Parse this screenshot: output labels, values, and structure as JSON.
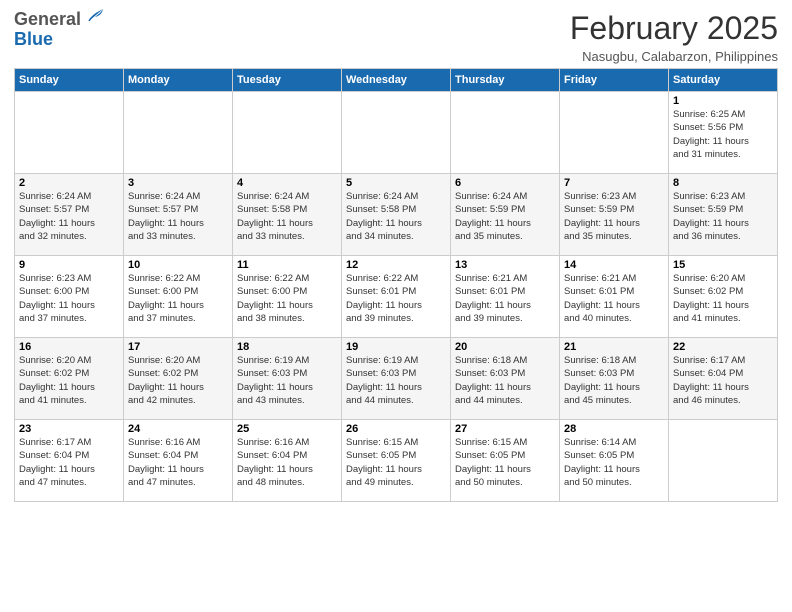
{
  "header": {
    "logo_general": "General",
    "logo_blue": "Blue",
    "month_title": "February 2025",
    "location": "Nasugbu, Calabarzon, Philippines"
  },
  "days_of_week": [
    "Sunday",
    "Monday",
    "Tuesday",
    "Wednesday",
    "Thursday",
    "Friday",
    "Saturday"
  ],
  "weeks": [
    [
      {
        "day": "",
        "info": ""
      },
      {
        "day": "",
        "info": ""
      },
      {
        "day": "",
        "info": ""
      },
      {
        "day": "",
        "info": ""
      },
      {
        "day": "",
        "info": ""
      },
      {
        "day": "",
        "info": ""
      },
      {
        "day": "1",
        "info": "Sunrise: 6:25 AM\nSunset: 5:56 PM\nDaylight: 11 hours\nand 31 minutes."
      }
    ],
    [
      {
        "day": "2",
        "info": "Sunrise: 6:24 AM\nSunset: 5:57 PM\nDaylight: 11 hours\nand 32 minutes."
      },
      {
        "day": "3",
        "info": "Sunrise: 6:24 AM\nSunset: 5:57 PM\nDaylight: 11 hours\nand 33 minutes."
      },
      {
        "day": "4",
        "info": "Sunrise: 6:24 AM\nSunset: 5:58 PM\nDaylight: 11 hours\nand 33 minutes."
      },
      {
        "day": "5",
        "info": "Sunrise: 6:24 AM\nSunset: 5:58 PM\nDaylight: 11 hours\nand 34 minutes."
      },
      {
        "day": "6",
        "info": "Sunrise: 6:24 AM\nSunset: 5:59 PM\nDaylight: 11 hours\nand 35 minutes."
      },
      {
        "day": "7",
        "info": "Sunrise: 6:23 AM\nSunset: 5:59 PM\nDaylight: 11 hours\nand 35 minutes."
      },
      {
        "day": "8",
        "info": "Sunrise: 6:23 AM\nSunset: 5:59 PM\nDaylight: 11 hours\nand 36 minutes."
      }
    ],
    [
      {
        "day": "9",
        "info": "Sunrise: 6:23 AM\nSunset: 6:00 PM\nDaylight: 11 hours\nand 37 minutes."
      },
      {
        "day": "10",
        "info": "Sunrise: 6:22 AM\nSunset: 6:00 PM\nDaylight: 11 hours\nand 37 minutes."
      },
      {
        "day": "11",
        "info": "Sunrise: 6:22 AM\nSunset: 6:00 PM\nDaylight: 11 hours\nand 38 minutes."
      },
      {
        "day": "12",
        "info": "Sunrise: 6:22 AM\nSunset: 6:01 PM\nDaylight: 11 hours\nand 39 minutes."
      },
      {
        "day": "13",
        "info": "Sunrise: 6:21 AM\nSunset: 6:01 PM\nDaylight: 11 hours\nand 39 minutes."
      },
      {
        "day": "14",
        "info": "Sunrise: 6:21 AM\nSunset: 6:01 PM\nDaylight: 11 hours\nand 40 minutes."
      },
      {
        "day": "15",
        "info": "Sunrise: 6:20 AM\nSunset: 6:02 PM\nDaylight: 11 hours\nand 41 minutes."
      }
    ],
    [
      {
        "day": "16",
        "info": "Sunrise: 6:20 AM\nSunset: 6:02 PM\nDaylight: 11 hours\nand 41 minutes."
      },
      {
        "day": "17",
        "info": "Sunrise: 6:20 AM\nSunset: 6:02 PM\nDaylight: 11 hours\nand 42 minutes."
      },
      {
        "day": "18",
        "info": "Sunrise: 6:19 AM\nSunset: 6:03 PM\nDaylight: 11 hours\nand 43 minutes."
      },
      {
        "day": "19",
        "info": "Sunrise: 6:19 AM\nSunset: 6:03 PM\nDaylight: 11 hours\nand 44 minutes."
      },
      {
        "day": "20",
        "info": "Sunrise: 6:18 AM\nSunset: 6:03 PM\nDaylight: 11 hours\nand 44 minutes."
      },
      {
        "day": "21",
        "info": "Sunrise: 6:18 AM\nSunset: 6:03 PM\nDaylight: 11 hours\nand 45 minutes."
      },
      {
        "day": "22",
        "info": "Sunrise: 6:17 AM\nSunset: 6:04 PM\nDaylight: 11 hours\nand 46 minutes."
      }
    ],
    [
      {
        "day": "23",
        "info": "Sunrise: 6:17 AM\nSunset: 6:04 PM\nDaylight: 11 hours\nand 47 minutes."
      },
      {
        "day": "24",
        "info": "Sunrise: 6:16 AM\nSunset: 6:04 PM\nDaylight: 11 hours\nand 47 minutes."
      },
      {
        "day": "25",
        "info": "Sunrise: 6:16 AM\nSunset: 6:04 PM\nDaylight: 11 hours\nand 48 minutes."
      },
      {
        "day": "26",
        "info": "Sunrise: 6:15 AM\nSunset: 6:05 PM\nDaylight: 11 hours\nand 49 minutes."
      },
      {
        "day": "27",
        "info": "Sunrise: 6:15 AM\nSunset: 6:05 PM\nDaylight: 11 hours\nand 50 minutes."
      },
      {
        "day": "28",
        "info": "Sunrise: 6:14 AM\nSunset: 6:05 PM\nDaylight: 11 hours\nand 50 minutes."
      },
      {
        "day": "",
        "info": ""
      }
    ]
  ]
}
